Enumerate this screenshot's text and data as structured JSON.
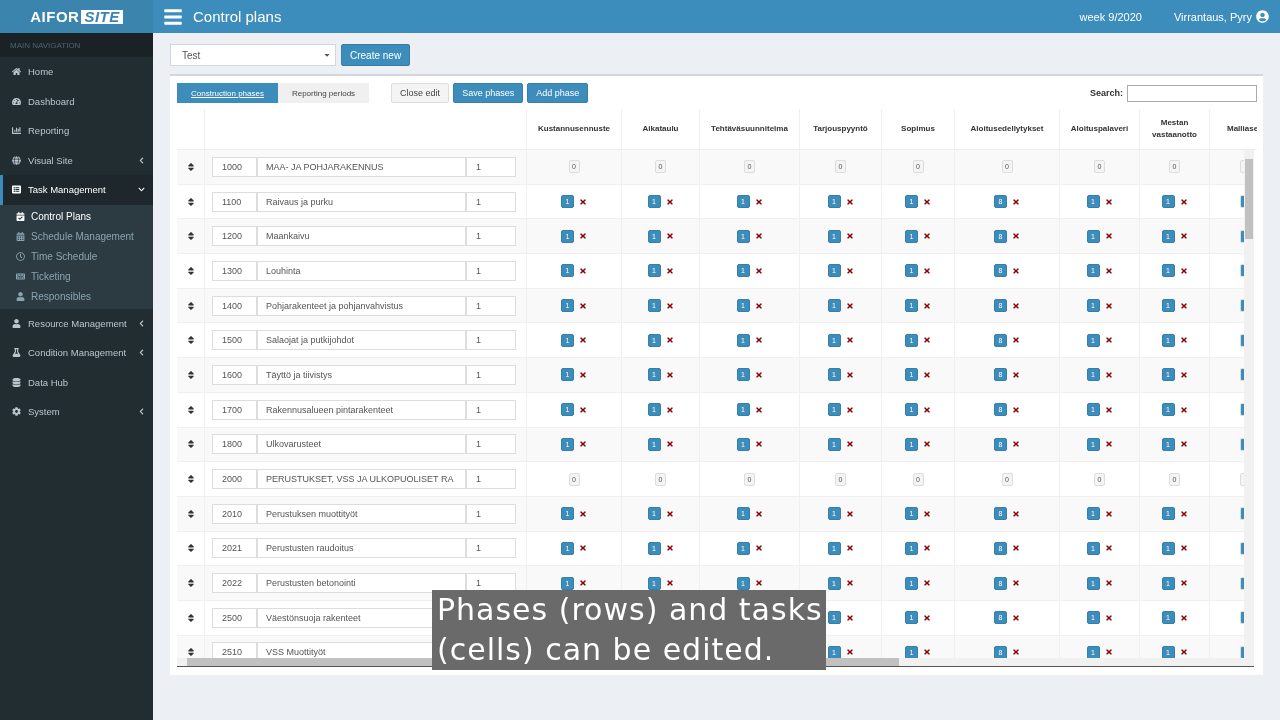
{
  "logo": {
    "part_1": "AIFOR",
    "part_2": "SITE"
  },
  "header": {
    "title": "Control plans",
    "week": "week 9/2020",
    "user": "Virrantaus, Pyry"
  },
  "sidebar": {
    "heading": "MAIN NAVIGATION",
    "items": [
      {
        "label": "Home",
        "kind": "link",
        "selected": false
      },
      {
        "label": "Dashboard",
        "kind": "link",
        "selected": false
      },
      {
        "label": "Reporting",
        "kind": "link",
        "selected": false
      },
      {
        "label": "Visual Site",
        "kind": "menu",
        "selected": false,
        "expanded": false
      },
      {
        "label": "Task Management",
        "kind": "menu",
        "selected": true,
        "expanded": true,
        "children": [
          {
            "label": "Control Plans",
            "selected": true
          },
          {
            "label": "Schedule Management",
            "selected": false
          },
          {
            "label": "Time Schedule",
            "selected": false
          },
          {
            "label": "Ticketing",
            "selected": false
          },
          {
            "label": "Responsibles",
            "selected": false
          }
        ]
      },
      {
        "label": "Resource Management",
        "kind": "menu",
        "selected": false,
        "expanded": false
      },
      {
        "label": "Condition Management",
        "kind": "menu",
        "selected": false,
        "expanded": false
      },
      {
        "label": "Data Hub",
        "kind": "link",
        "selected": false
      },
      {
        "label": "System",
        "kind": "menu",
        "selected": false,
        "expanded": false
      }
    ]
  },
  "plan_select": {
    "value": "Test"
  },
  "create_button": "Create new",
  "tabs": [
    {
      "label": "Construction phases",
      "selected": true
    },
    {
      "label": "Reporting periods",
      "selected": false
    }
  ],
  "actions": [
    {
      "label": "Close edit",
      "kind": "default"
    },
    {
      "label": "Save phases",
      "kind": "primary"
    },
    {
      "label": "Add phase",
      "kind": "primary"
    }
  ],
  "search": {
    "label": "Search:"
  },
  "table": {
    "columns": [
      "Kustannusennuste",
      "Aikataulu",
      "Tehtäväsuunnitelma",
      "Tarjouspyyntö",
      "Sopimus",
      "Aloitusedellytykset",
      "Aloituspalaveri",
      "Mestan vastaanotto",
      "Malliase"
    ],
    "rows": [
      {
        "code": "1000",
        "name": "MAA- JA POHJARAKENNUS",
        "count": "1",
        "kind": "heading",
        "tasks": [
          "0",
          "0",
          "0",
          "0",
          "0",
          "0",
          "0",
          "0"
        ]
      },
      {
        "code": "1100",
        "name": "Raivaus ja purku",
        "count": "1",
        "kind": "phase",
        "tasks": [
          "1",
          "1",
          "1",
          "1",
          "1",
          "8",
          "1",
          "1"
        ]
      },
      {
        "code": "1200",
        "name": "Maankaivu",
        "count": "1",
        "kind": "phase",
        "tasks": [
          "1",
          "1",
          "1",
          "1",
          "1",
          "8",
          "1",
          "1"
        ]
      },
      {
        "code": "1300",
        "name": "Louhinta",
        "count": "1",
        "kind": "phase",
        "tasks": [
          "1",
          "1",
          "1",
          "1",
          "1",
          "8",
          "1",
          "1"
        ]
      },
      {
        "code": "1400",
        "name": "Pohjarakenteet ja pohjanvahvistus",
        "count": "1",
        "kind": "phase",
        "tasks": [
          "1",
          "1",
          "1",
          "1",
          "1",
          "8",
          "1",
          "1"
        ]
      },
      {
        "code": "1500",
        "name": "Salaojat ja putkijohdot",
        "count": "1",
        "kind": "phase",
        "tasks": [
          "1",
          "1",
          "1",
          "1",
          "1",
          "8",
          "1",
          "1"
        ]
      },
      {
        "code": "1600",
        "name": "Täyttö ja tiivistys",
        "count": "1",
        "kind": "phase",
        "tasks": [
          "1",
          "1",
          "1",
          "1",
          "1",
          "8",
          "1",
          "1"
        ]
      },
      {
        "code": "1700",
        "name": "Rakennusalueen pintarakenteet",
        "count": "1",
        "kind": "phase",
        "tasks": [
          "1",
          "1",
          "1",
          "1",
          "1",
          "8",
          "1",
          "1"
        ]
      },
      {
        "code": "1800",
        "name": "Ulkovarusteet",
        "count": "1",
        "kind": "phase",
        "tasks": [
          "1",
          "1",
          "1",
          "1",
          "1",
          "8",
          "1",
          "1"
        ]
      },
      {
        "code": "2000",
        "name": "PERUSTUKSET, VSS JA ULKOPUOLISET RA",
        "count": "1",
        "kind": "heading",
        "tasks": [
          "0",
          "0",
          "0",
          "0",
          "0",
          "0",
          "0",
          "0"
        ]
      },
      {
        "code": "2010",
        "name": "Perustuksen muottityöt",
        "count": "1",
        "kind": "phase",
        "tasks": [
          "1",
          "1",
          "1",
          "1",
          "1",
          "8",
          "1",
          "1"
        ]
      },
      {
        "code": "2021",
        "name": "Perustusten raudoitus",
        "count": "1",
        "kind": "phase",
        "tasks": [
          "1",
          "1",
          "1",
          "1",
          "1",
          "8",
          "1",
          "1"
        ]
      },
      {
        "code": "2022",
        "name": "Perustusten betonointi",
        "count": "1",
        "kind": "phase",
        "tasks": [
          "1",
          "1",
          "1",
          "1",
          "1",
          "8",
          "1",
          "1"
        ]
      },
      {
        "code": "2500",
        "name": "Väestönsuoja rakenteet",
        "kind": "phase",
        "tasks": [
          "1",
          "1",
          "8",
          "1",
          "1"
        ]
      },
      {
        "code": "2510",
        "name": "VSS Muottityöt",
        "kind": "phase",
        "tasks": [
          "1",
          "1",
          "8",
          "1",
          "1"
        ]
      }
    ]
  },
  "caption": {
    "line_1": "Phases (rows) and tasks",
    "line_2": "(cells) can be edited."
  }
}
